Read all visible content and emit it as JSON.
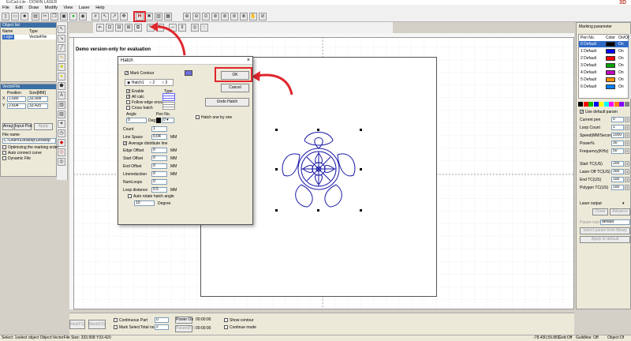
{
  "window": {
    "title": "EzCad-Lite - DOWIN LASER",
    "brand": "3D"
  },
  "menu": [
    "File",
    "Edit",
    "Draw",
    "Modify",
    "View",
    "Laser",
    "Help"
  ],
  "object_list": {
    "title": "Object list",
    "col_name": "Name",
    "col_type": "Type",
    "row_name": "Logo",
    "row_type": "VectorFile"
  },
  "vectorfile_panel": {
    "title": "VectorFile",
    "col_position": "Position",
    "col_size": "Size[MM]",
    "x_label": "X",
    "x_pos": "1.685",
    "x_size": "33.908",
    "y_label": "Y",
    "y_pos": "2.604",
    "y_size": "33.420",
    "array_btn": "Array",
    "input_port_btn": "Input Port",
    "apply_btn": "Apply",
    "file_name_label": "File name",
    "file_path": "C:\\Users\\Desktop\\Desktop",
    "opt1": "Optimizing the marking order",
    "opt2": "Auto connect curve",
    "opt3": "Dynamic File"
  },
  "canvas": {
    "demo_text": "Demo version-only for evaluation"
  },
  "hatch_dialog": {
    "title": "Hatch",
    "close": "×",
    "mark_contour": "Mark Contour",
    "tabs": [
      "Hatch1",
      "2",
      "3"
    ],
    "enable": "Enable",
    "type_label": "Type",
    "all_calc": "All calc",
    "follow_edge": "Follow edge once",
    "cross_hatch": "Cross hatch",
    "angle_label": "Angle",
    "angle_value": "0",
    "deg_label": "Deg",
    "pen_label": "Pen No.",
    "pen_value": "0",
    "count_label": "Count",
    "count_value": "1",
    "line_space_label": "Line Space",
    "line_space_value": "0.04",
    "mm": "MM",
    "avg_distribute": "Average distribute line",
    "edge_offset_label": "Edge Offset",
    "edge_offset_value": "0",
    "start_offset_label": "Start Offset",
    "start_offset_value": "0",
    "end_offset_label": "End Offset",
    "end_offset_value": "0",
    "line_reduction_label": "Linereduction",
    "line_reduction_value": "0",
    "num_loops_label": "NumLoops",
    "num_loops_value": "0",
    "loop_distance_label": "Loop distance",
    "loop_distance_value": "0.5",
    "auto_rotate": "Auto rotate hatch angle",
    "rotate_value": "10",
    "degree_label": "Degree",
    "ok_btn": "OK",
    "cancel_btn": "Cancel",
    "undo_btn": "Undo Hatch",
    "hatch_one": "Hatch one by one"
  },
  "marking_param": {
    "title": "Marking parameter",
    "col_pen": "Pen No.",
    "col_color": "Color",
    "col_onoff": "On/Off",
    "pens": [
      {
        "name": "0 Default",
        "color": "#000000",
        "state": "On"
      },
      {
        "name": "1 Default",
        "color": "#0000ff",
        "state": "On"
      },
      {
        "name": "2 Default",
        "color": "#ff0000",
        "state": "On"
      },
      {
        "name": "3 Default",
        "color": "#00a000",
        "state": "On"
      },
      {
        "name": "4 Default",
        "color": "#c000c0",
        "state": "On"
      },
      {
        "name": "5 Default",
        "color": "#ff9000",
        "state": "On"
      },
      {
        "name": "6 Default",
        "color": "#0080ff",
        "state": "On"
      }
    ],
    "palette": [
      "#000000",
      "#ff0000",
      "#00c000",
      "#0000ff",
      "#ffff00",
      "#00ffff",
      "#ff00ff",
      "#ff8000",
      "#8000ff",
      "#808080"
    ],
    "use_default": "Use default param",
    "fields": [
      {
        "label": "Current pen",
        "value": "0"
      },
      {
        "label": "Loop Count",
        "value": "1"
      },
      {
        "label": "Speed(MM/Second)",
        "value": "1000"
      },
      {
        "label": "Power%",
        "value": "30"
      },
      {
        "label": "Frequency(KHz)",
        "value": "50"
      }
    ],
    "fields2": [
      {
        "label": "Start TC(US)",
        "value": "200"
      },
      {
        "label": "Laser Off TC(US)",
        "value": "300"
      },
      {
        "label": "End TC(US)",
        "value": "100"
      },
      {
        "label": "Polygon TC(US)",
        "value": "100"
      }
    ],
    "laser_output": "Laser output",
    "close_btn": "Close",
    "advance_btn": "Advance",
    "param_name_label": "Param name",
    "param_name_value": "default",
    "select_btn": "Select param from library",
    "apply_btn": "Apply to default"
  },
  "bottom": {
    "red_btn": "Red(F1)",
    "mark_btn": "Mark(F2)",
    "continuous": "Continuous",
    "part_label": "Part",
    "part_value": "0",
    "mark_select": "Mark Select",
    "total_label": "Total no.",
    "total_value": "2",
    "power_on": "Power On",
    "power_time": "00:00:00",
    "param_btn": "Param(F3)",
    "param_time": "00:00:00",
    "show_contour": "Show contour",
    "continue_mode": "Continue mode"
  },
  "status": {
    "left": "Select: 1select object Object:VectorFile Size: 333.908 Y33.420",
    "coords": "-78.430,59.881",
    "grid": "Grid:Off",
    "guideline": "Guildline: Off",
    "object": "Object:Of"
  }
}
